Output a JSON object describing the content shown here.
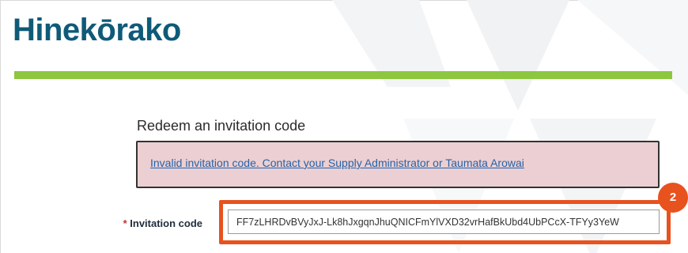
{
  "brand": {
    "title": "Hinekōrako"
  },
  "colors": {
    "brand_blue": "#0f5a78",
    "accent_green": "#8dc63f",
    "error_background": "#eccfd2",
    "link_blue": "#2563a8",
    "highlight_orange": "#e8521f"
  },
  "redeem": {
    "heading": "Redeem an invitation code",
    "error_message": "Invalid invitation code. Contact your Supply Administrator or Taumata Arowai",
    "field": {
      "required_marker": "*",
      "label": "Invitation code",
      "value": "FF7zLHRDvBVyJxJ-Lk8hJxgqnJhuQNICFmYlVXD32vrHafBkUbd4UbPCcX-TFYy3YeW"
    }
  },
  "annotation": {
    "step_number": "2"
  }
}
